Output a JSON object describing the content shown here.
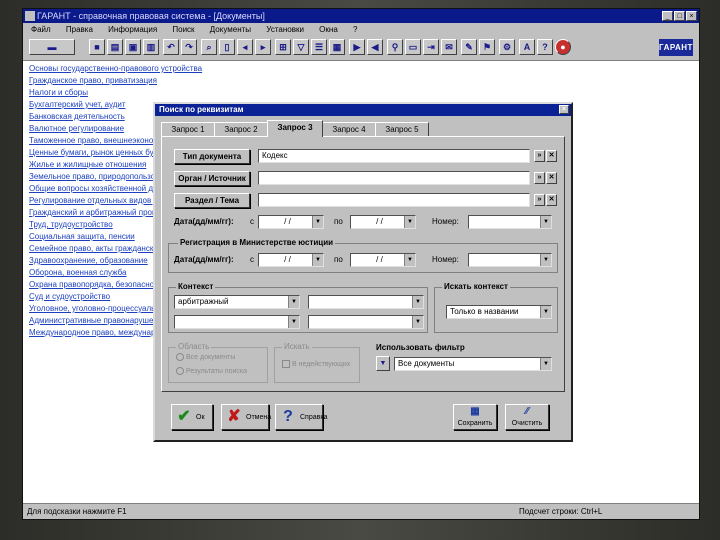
{
  "app": {
    "title": "ГАРАНТ - справочная правовая система - [Документы]",
    "menu": [
      "Файл",
      "Правка",
      "Информация",
      "Поиск",
      "Документы",
      "Установки",
      "Окна",
      "?"
    ],
    "logo": "ГАРАНТ"
  },
  "doc_list": [
    "Основы государственно-правового устройства",
    "Гражданское право, приватизация",
    "Налоги и сборы",
    "Бухгалтерский учет, аудит",
    "Банковская деятельность",
    "Валютное регулирование",
    "Таможенное право, внешнеэкономическая деятельность",
    "Ценные бумаги, рынок ценных бумаг",
    "Жилье и жилищные отношения",
    "Земельное право, природопользование",
    "Общие вопросы хозяйственной деятельности",
    "Регулирование отдельных видов деятельности",
    "Гражданский и арбитражный процесс",
    "Труд, трудоустройство",
    "Социальная защита, пенсии",
    "Семейное право, акты гражданского состояния",
    "Здравоохранение, образование",
    "Оборона, военная служба",
    "Охрана правопорядка, безопасность",
    "Суд и судоустройство",
    "Уголовное, уголовно-процессуальное право",
    "Административные правонарушения",
    "Международное право, международные отношения"
  ],
  "status": {
    "left": "Для подсказки нажмите F1",
    "right": "Подсчет строки: Ctrl+L"
  },
  "dialog": {
    "title": "Поиск по реквизитам",
    "close": "×",
    "tabs": [
      "Запрос 1",
      "Запрос 2",
      "Запрос 3",
      "Запрос 4",
      "Запрос 5"
    ],
    "active_tab": 2,
    "doc_type": {
      "button": "Тип документа",
      "value": "Кодекс"
    },
    "organ": {
      "button": "Орган / Источник",
      "value": ""
    },
    "section": {
      "button": "Раздел / Тема",
      "value": ""
    },
    "date_label": "Дата(дд/мм/гг):",
    "date_from_label": "с",
    "date_from": "/ /",
    "date_to_label": "по",
    "date_to": "/ /",
    "number_label": "Номер:",
    "number": "",
    "registration_title": "Регистрация в Министерстве юстиции",
    "reg_date_label": "Дата(дд/мм/гг):",
    "reg_date_from_label": "с",
    "reg_date_from": "/ /",
    "reg_date_to_label": "по",
    "reg_date_to": "/ /",
    "reg_number_label": "Номер:",
    "reg_number": "",
    "context_label": "Контекст",
    "context_word1": "арбитражный",
    "context_word2": "",
    "context_word3": "",
    "context_word4": "",
    "search_context_label": "Искать контекст",
    "search_context_value": "Только в названии",
    "scope_label": "Область",
    "scope_opt1": "Все документы",
    "scope_opt2": "Результаты поиска",
    "search_label": "Искать",
    "search_opt1": "В недействующих",
    "filter_label": "Использовать фильтр",
    "filter_value": "Все документы",
    "ok": "Ок",
    "cancel": "Отмена",
    "help": "Справка",
    "save": "Сохранить",
    "clear": "Очистить",
    "icons": {
      "ok": "✔",
      "cancel": "✘",
      "help": "?",
      "save": "▦",
      "clear": "⁄⁄",
      "browse": "»",
      "clear_field": "✕",
      "filter": "▼"
    }
  }
}
